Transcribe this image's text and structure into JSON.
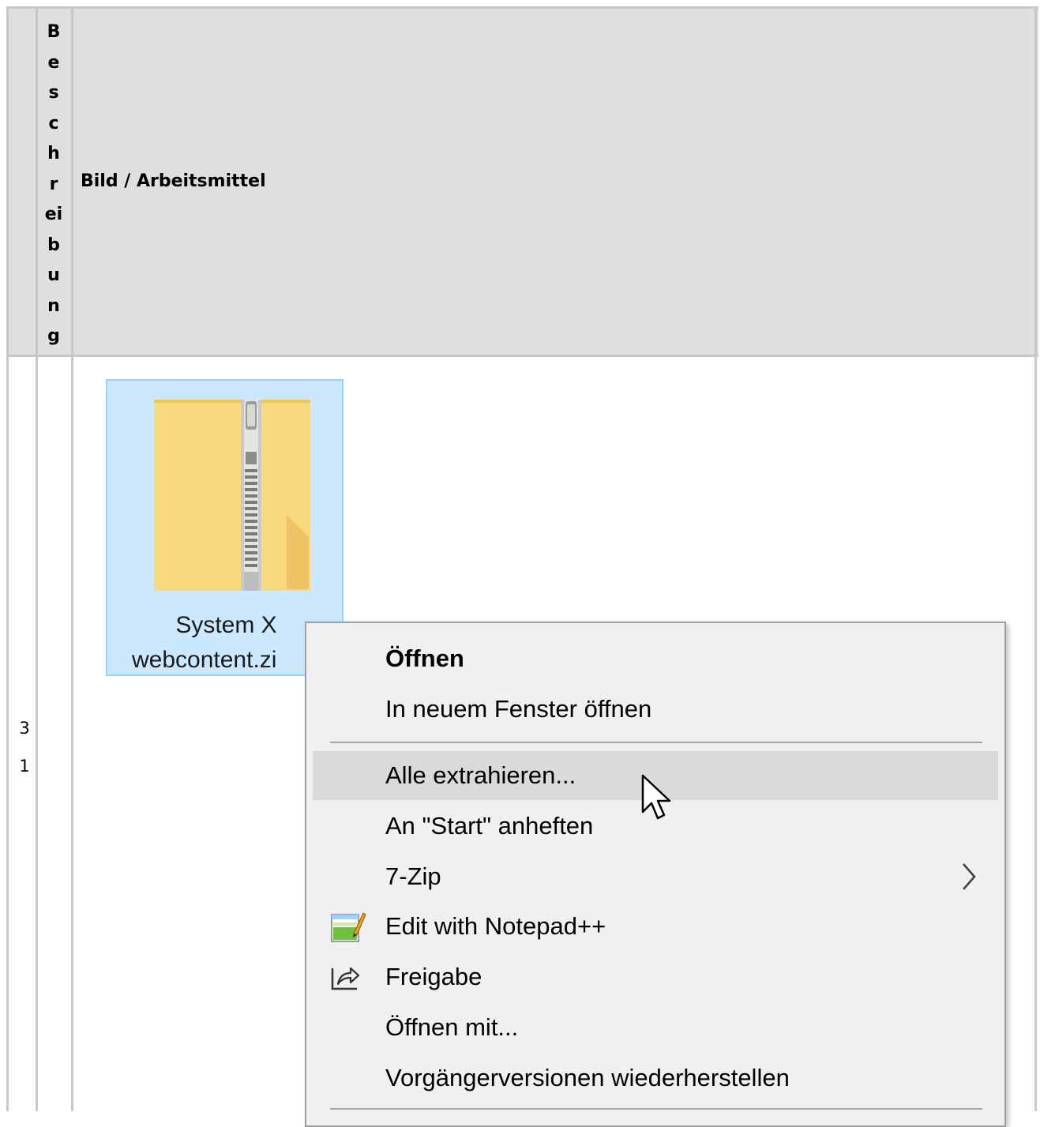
{
  "table": {
    "header": {
      "col2_label": "Beschreibung",
      "col2_letters": [
        "B",
        "e",
        "s",
        "c",
        "h",
        "r",
        "ei",
        "b",
        "u",
        "n",
        "g"
      ],
      "col3_label": "Bild / Arbeitsmittel"
    },
    "row": {
      "number": "31",
      "number_lines": [
        "3",
        "1"
      ]
    }
  },
  "file": {
    "name_line1": "System X",
    "name_line2": "webcontent.zi",
    "icon": "zip-folder-icon"
  },
  "context_menu": {
    "items": [
      {
        "label": "Öffnen",
        "bold": true
      },
      {
        "label": "In neuem Fenster öffnen"
      },
      {
        "label": "Alle extrahieren...",
        "hovered": true
      },
      {
        "label": "An \"Start\" anheften"
      },
      {
        "label": "7-Zip",
        "submenu": true,
        "icon": "chevron-right-icon"
      },
      {
        "label": "Edit with Notepad++",
        "icon": "notepad-plus-plus-icon"
      },
      {
        "label": "Freigabe",
        "icon": "share-icon"
      },
      {
        "label": "Öffnen mit..."
      },
      {
        "label": "Vorgängerversionen wiederherstellen"
      }
    ]
  },
  "colors": {
    "header_bg": "#dfdfdf",
    "border": "#c8c8c8",
    "selection_bg": "#cce8ff",
    "selection_border": "#99d1ff",
    "menu_bg": "#f0f0f0",
    "menu_hover": "#dadada"
  }
}
